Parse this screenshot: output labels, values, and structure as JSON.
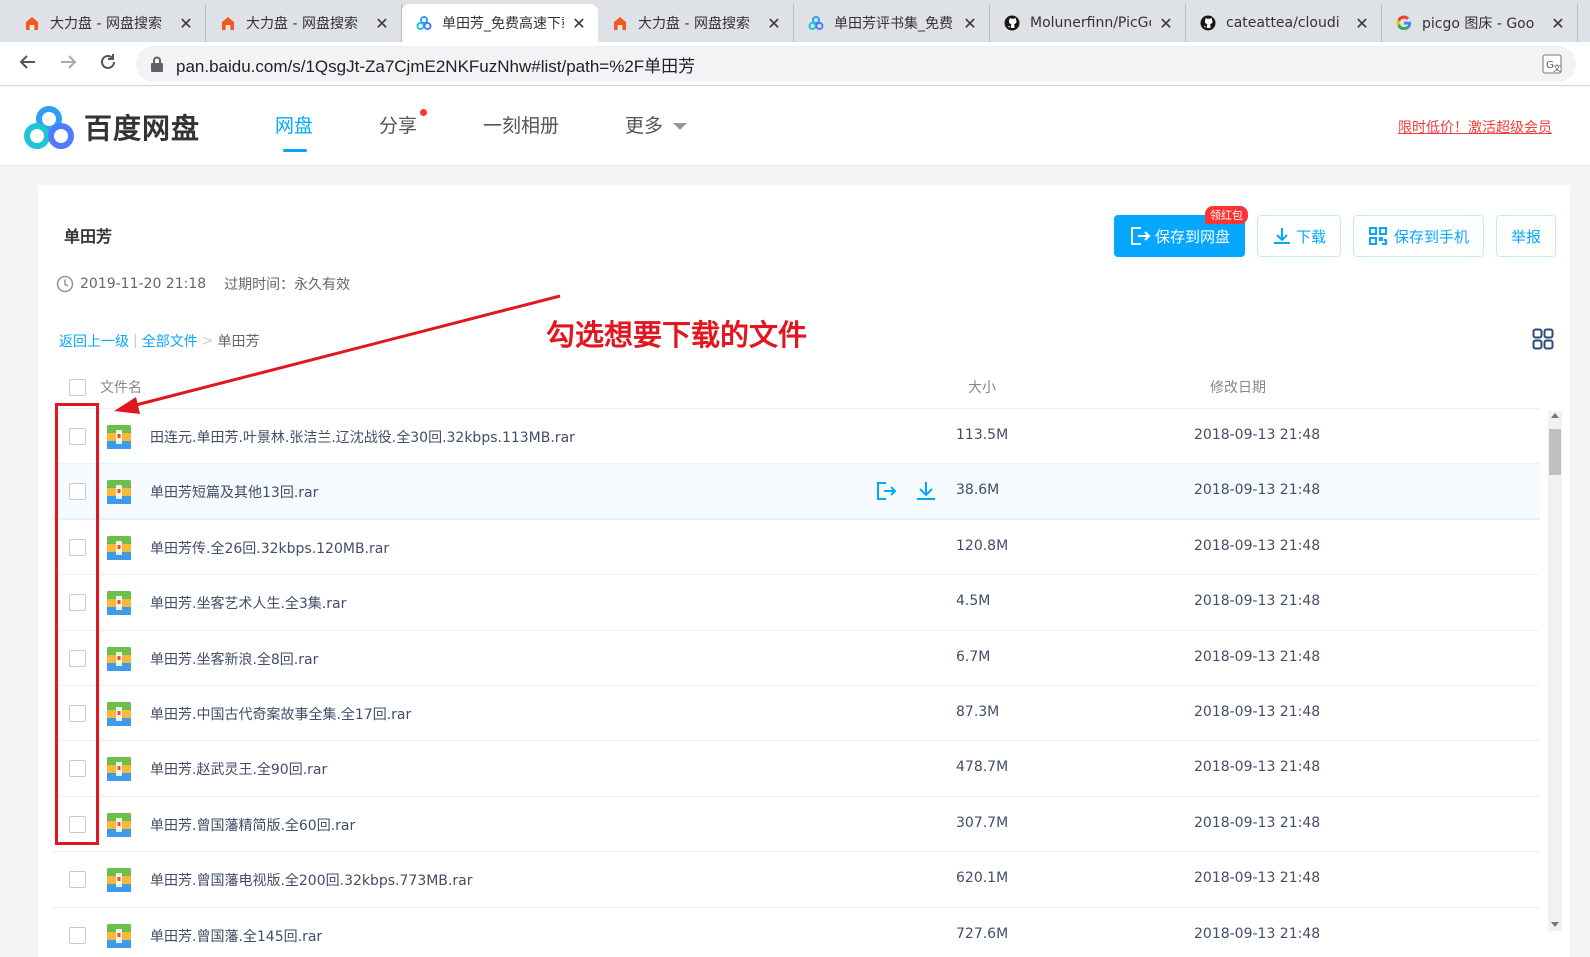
{
  "browser": {
    "tabs": [
      {
        "title": "大力盘 - 网盘搜索",
        "icon": "dalipan",
        "active": false
      },
      {
        "title": "大力盘 - 网盘搜索",
        "icon": "dalipan",
        "active": false
      },
      {
        "title": "单田芳_免费高速下载",
        "icon": "baidupan",
        "active": true
      },
      {
        "title": "大力盘 - 网盘搜索",
        "icon": "dalipan",
        "active": false
      },
      {
        "title": "单田芳评书集_免费",
        "icon": "baidupan",
        "active": false
      },
      {
        "title": "Molunerfinn/PicGo",
        "icon": "github",
        "active": false
      },
      {
        "title": "cateattea/cloudi",
        "icon": "github",
        "active": false
      },
      {
        "title": "picgo 图床 - Goo",
        "icon": "google",
        "active": false
      }
    ],
    "url": "pan.baidu.com/s/1QsgJt-Za7CjmE2NKFuzNhw#list/path=%2F单田芳"
  },
  "site": {
    "logo_text": "百度网盘",
    "nav": [
      {
        "label": "网盘",
        "active": true
      },
      {
        "label": "分享",
        "dot": true
      },
      {
        "label": "一刻相册"
      },
      {
        "label": "更多",
        "dropdown": true
      }
    ],
    "promo": "限时低价！激活超级会员"
  },
  "share": {
    "title": "单田芳",
    "created": "2019-11-20 21:18",
    "expire": "过期时间：永久有效",
    "buttons": {
      "save": "保存到网盘",
      "save_badge": "领红包",
      "download": "下载",
      "save_phone": "保存到手机",
      "report": "举报"
    },
    "breadcrumb": {
      "back": "返回上一级",
      "all": "全部文件",
      "current": "单田芳"
    },
    "columns": {
      "name": "文件名",
      "size": "大小",
      "date": "修改日期"
    },
    "files": [
      {
        "name": "田连元.单田芳.叶景林.张洁兰.辽沈战役.全30回.32kbps.113MB.rar",
        "size": "113.5M",
        "date": "2018-09-13 21:48"
      },
      {
        "name": "单田芳短篇及其他13回.rar",
        "size": "38.6M",
        "date": "2018-09-13 21:48",
        "hover": true
      },
      {
        "name": "单田芳传.全26回.32kbps.120MB.rar",
        "size": "120.8M",
        "date": "2018-09-13 21:48"
      },
      {
        "name": "单田芳.坐客艺术人生.全3集.rar",
        "size": "4.5M",
        "date": "2018-09-13 21:48"
      },
      {
        "name": "单田芳.坐客新浪.全8回.rar",
        "size": "6.7M",
        "date": "2018-09-13 21:48"
      },
      {
        "name": "单田芳.中国古代奇案故事全集.全17回.rar",
        "size": "87.3M",
        "date": "2018-09-13 21:48"
      },
      {
        "name": "单田芳.赵武灵王.全90回.rar",
        "size": "478.7M",
        "date": "2018-09-13 21:48"
      },
      {
        "name": "单田芳.曾国藩精简版.全60回.rar",
        "size": "307.7M",
        "date": "2018-09-13 21:48"
      },
      {
        "name": "单田芳.曾国藩电视版.全200回.32kbps.773MB.rar",
        "size": "620.1M",
        "date": "2018-09-13 21:48"
      },
      {
        "name": "单田芳.曾国藩.全145回.rar",
        "size": "727.6M",
        "date": "2018-09-13 21:48"
      }
    ]
  },
  "annotation": {
    "text": "勾选想要下载的文件",
    "color": "#e1161f"
  },
  "colors": {
    "accent": "#06a7ff",
    "promo": "#f23c3c"
  }
}
